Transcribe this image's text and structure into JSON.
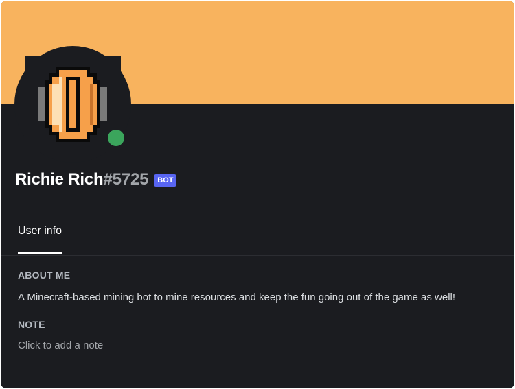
{
  "profile": {
    "username": "Richie Rich",
    "discriminator": "#5725",
    "badge": "BOT",
    "status": "online"
  },
  "colors": {
    "banner": "#f8b35e",
    "status_online": "#3ba55c",
    "badge_bg": "#5865f2",
    "card_bg": "#1b1c20"
  },
  "avatar": {
    "icon": "gold-coin-icon"
  },
  "tabs": [
    {
      "label": "User info",
      "active": true
    }
  ],
  "about": {
    "title": "ABOUT ME",
    "text": "A Minecraft-based mining bot to mine resources and keep the fun going out of the game as well!"
  },
  "note": {
    "title": "NOTE",
    "placeholder": "Click to add a note"
  }
}
